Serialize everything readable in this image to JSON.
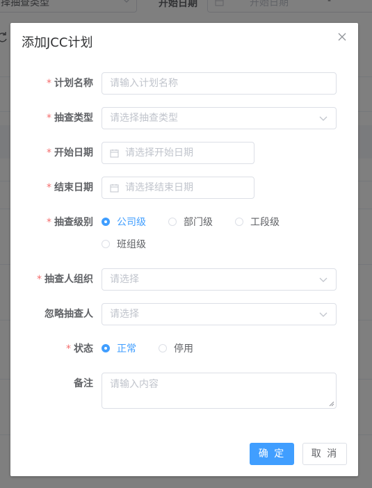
{
  "background": {
    "type_select_text": "择抽查类型",
    "start_date_label": "开始日期",
    "start_date_placeholder": "开始日期",
    "range_separator": "-"
  },
  "dialog": {
    "title": "添加JCC计划",
    "fields": {
      "plan_name": {
        "label": "计划名称",
        "placeholder": "请输入计划名称",
        "required": "*"
      },
      "check_type": {
        "label": "抽查类型",
        "placeholder": "请选择抽查类型",
        "required": "*"
      },
      "start_date": {
        "label": "开始日期",
        "placeholder": "请选择开始日期",
        "required": "*"
      },
      "end_date": {
        "label": "结束日期",
        "placeholder": "请选择结束日期",
        "required": "*"
      },
      "check_level": {
        "label": "抽查级别",
        "required": "*",
        "options": [
          "公司级",
          "部门级",
          "工段级",
          "班组级"
        ],
        "selected": "公司级"
      },
      "check_org": {
        "label": "抽查人组织",
        "placeholder": "请选择",
        "required": "*"
      },
      "ignore_checker": {
        "label": "忽略抽查人",
        "placeholder": "请选择"
      },
      "status": {
        "label": "状态",
        "required": "*",
        "options": [
          "正常",
          "停用"
        ],
        "selected": "正常"
      },
      "remark": {
        "label": "备注",
        "placeholder": "请输入内容"
      }
    },
    "buttons": {
      "confirm": "确 定",
      "cancel": "取 消"
    }
  },
  "colors": {
    "primary": "#409eff",
    "required": "#f56c6c",
    "border": "#dcdfe6",
    "placeholder": "#c0c4cc"
  },
  "icons": [
    "chevron-down-icon",
    "calendar-icon",
    "close-icon",
    "refresh-icon",
    "resize-grip-icon"
  ]
}
